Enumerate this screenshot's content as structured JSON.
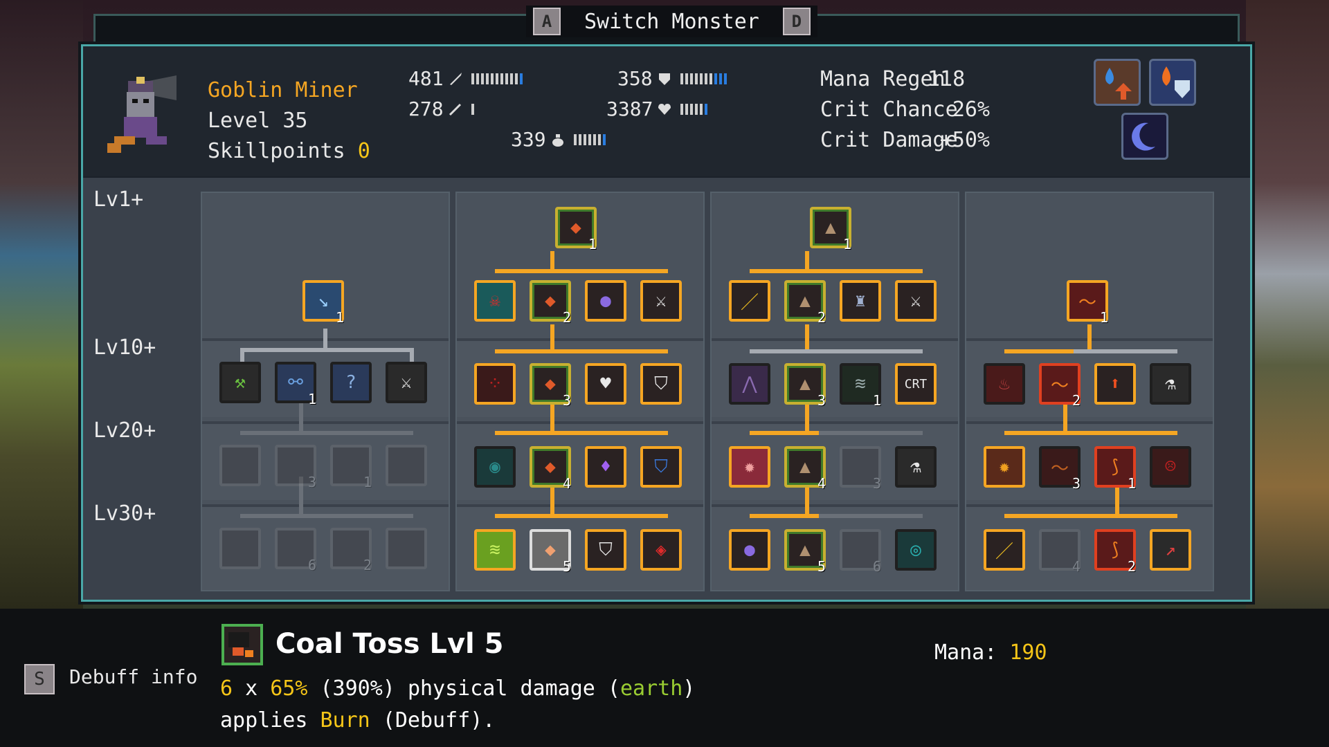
{
  "title": {
    "key_left": "A",
    "label": "Switch Monster",
    "key_right": "D"
  },
  "monster": {
    "name": "Goblin Miner",
    "level": "Level 35",
    "skillpoints_label": "Skillpoints",
    "skillpoints_value": "0"
  },
  "stats": {
    "attack": "481",
    "defense": "358",
    "magic": "278",
    "health": "3387",
    "mana": "339",
    "mana_regen_label": "Mana Regen",
    "mana_regen_value": "118",
    "crit_chance_label": "Crit Chance",
    "crit_chance_value": "26%",
    "crit_damage_label": "Crit Damage",
    "crit_damage_value": "+50%"
  },
  "element_icons": [
    "water-up-icon",
    "fire-shield-icon",
    "moon-icon"
  ],
  "rows": [
    "Lv1+",
    "Lv10+",
    "Lv20+",
    "Lv30+"
  ],
  "skill_levels": {
    "c1_lv1": "1",
    "c2_lv1": "1",
    "c3_lv1": "1",
    "c4_lv1": "1",
    "c1_lv10_b": "1",
    "c2_lv1b": "2",
    "c3_lv1b": "2",
    "c2_lv10": "3",
    "c3_lv10": "3",
    "c3_lv10_c": "1",
    "c4_lv10": "2",
    "c1_lv20_b": "3",
    "c1_lv20_c": "1",
    "c2_lv20": "4",
    "c3_lv20": "4",
    "c3_lv20_c": "3",
    "c4_lv20_c": "3",
    "c4_lv20_d": "1",
    "c1_lv30_b": "6",
    "c1_lv30_c": "2",
    "c2_lv30": "5",
    "c3_lv30": "5",
    "c3_lv30_c": "6",
    "c4_lv30_b": "4",
    "c4_lv30_c": "2",
    "crt_text": "CRT"
  },
  "info": {
    "debuff_key": "S",
    "debuff_label": "Debuff info",
    "skill_title": "Coal Toss Lvl 5",
    "mana_label": "Mana:",
    "mana_value": "190",
    "hits": "6",
    "x": "x",
    "pct": "65%",
    "total": "(390%)",
    "dmg_text": "physical damage (",
    "element": "earth",
    "close": ")",
    "applies": "applies",
    "effect": "Burn",
    "effect_tail": "(Debuff)."
  },
  "colors": {
    "accent": "#f5a623",
    "highlight": "#f5c518",
    "border": "#4aa8a8",
    "earth": "#9acd32"
  }
}
